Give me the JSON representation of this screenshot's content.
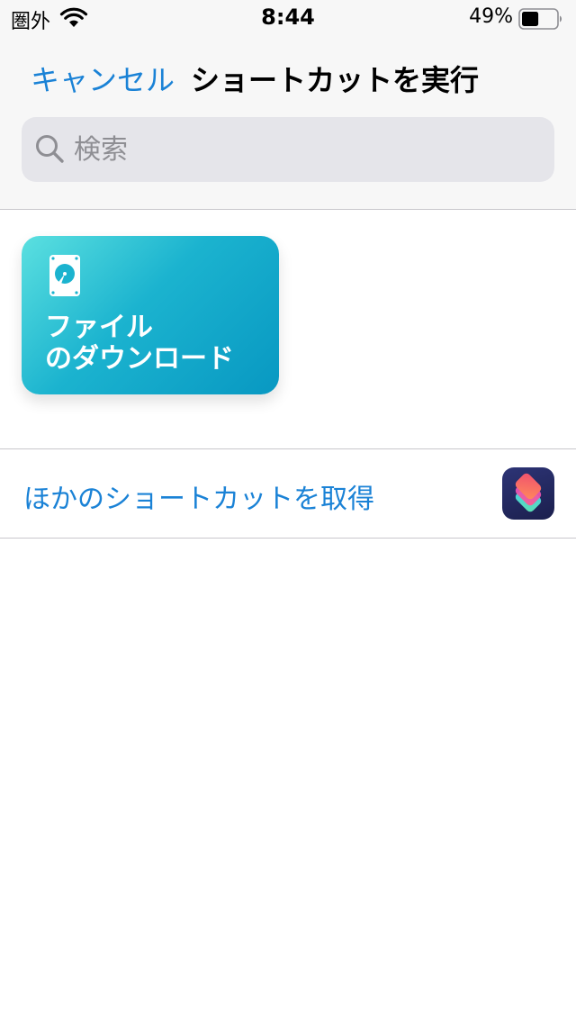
{
  "status_bar": {
    "carrier": "圏外",
    "time": "8:44",
    "battery_percent": "49%",
    "battery_level": 0.49
  },
  "nav": {
    "cancel_label": "キャンセル",
    "title": "ショートカットを実行"
  },
  "search": {
    "placeholder": "検索",
    "value": ""
  },
  "shortcuts": [
    {
      "title": "ファイル\nのダウンロード",
      "icon": "hard-drive-icon",
      "gradient_start": "#5be0e0",
      "gradient_end": "#0898c2"
    }
  ],
  "get_more": {
    "label": "ほかのショートカットを取得",
    "icon": "shortcuts-app-icon"
  },
  "colors": {
    "accent": "#1a82d6",
    "header_background": "#f7f7f7",
    "search_background": "#e5e5ea",
    "separator": "#c8c7cc"
  }
}
